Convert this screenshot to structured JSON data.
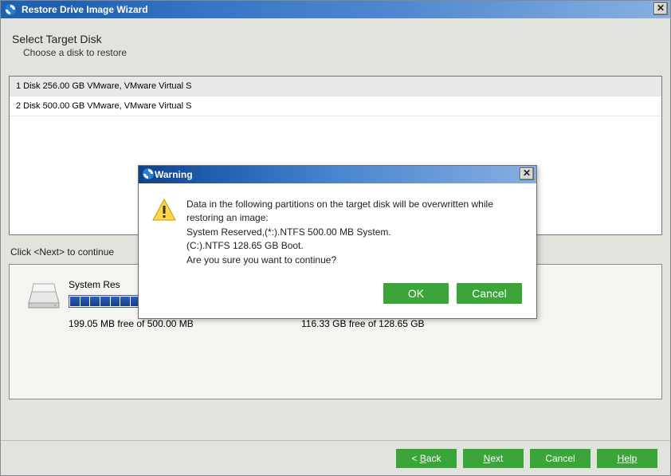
{
  "window": {
    "title": "Restore Drive Image Wizard"
  },
  "page": {
    "heading": "Select Target Disk",
    "subheading": "Choose a disk to restore",
    "hint": "Click <Next> to continue"
  },
  "disks": [
    {
      "label": "1 Disk 256.00 GB VMware,  VMware Virtual S",
      "selected": true
    },
    {
      "label": "2 Disk 500.00 GB VMware,  VMware Virtual S",
      "selected": false
    }
  ],
  "partitions": [
    {
      "name": "System Res",
      "free": "199.05 MB free of 500.00 MB",
      "segments": 14,
      "filled": 14,
      "size": "normal"
    },
    {
      "name": "",
      "free": "116.33 GB free of 128.65 GB",
      "segments": 3,
      "filled": 3,
      "size": "small"
    }
  ],
  "footer": {
    "back": "< Back",
    "next": "Next",
    "cancel": "Cancel",
    "help": "Help"
  },
  "dialog": {
    "title": "Warning",
    "lines": [
      "Data in the following partitions on the target disk will be overwritten while restoring an image:",
      "System Reserved,(*:).NTFS 500.00 MB System.",
      "(C:).NTFS 128.65 GB Boot.",
      "Are you sure you want to continue?"
    ],
    "ok": "OK",
    "cancel": "Cancel"
  }
}
